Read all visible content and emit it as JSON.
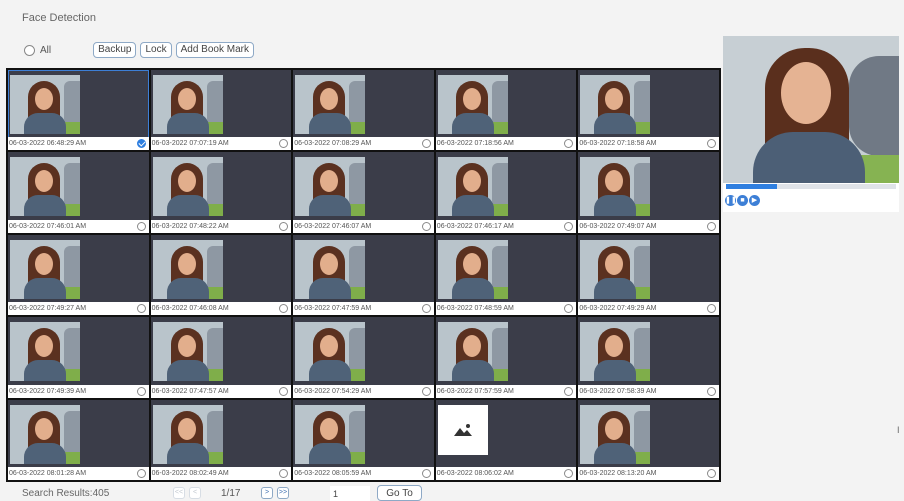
{
  "title": "Face Detection",
  "toolbar": {
    "all_label": "All",
    "backup_label": "Backup",
    "lock_label": "Lock",
    "bookmark_label": "Add Book Mark"
  },
  "grid": {
    "items": [
      {
        "timestamp": "06-03-2022 06:48:29 AM",
        "checked": true
      },
      {
        "timestamp": "06-03-2022 07:07:19 AM",
        "checked": false
      },
      {
        "timestamp": "06-03-2022 07:08:29 AM",
        "checked": false
      },
      {
        "timestamp": "06-03-2022 07:18:56 AM",
        "checked": false
      },
      {
        "timestamp": "06-03-2022 07:18:58 AM",
        "checked": false
      },
      {
        "timestamp": "06-03-2022 07:46:01 AM",
        "checked": false
      },
      {
        "timestamp": "06-03-2022 07:48:22 AM",
        "checked": false
      },
      {
        "timestamp": "06-03-2022 07:46:07 AM",
        "checked": false
      },
      {
        "timestamp": "06-03-2022 07:46:17 AM",
        "checked": false
      },
      {
        "timestamp": "06-03-2022 07:49:07 AM",
        "checked": false
      },
      {
        "timestamp": "06-03-2022 07:49:27 AM",
        "checked": false
      },
      {
        "timestamp": "06-03-2022 07:46:08 AM",
        "checked": false
      },
      {
        "timestamp": "06-03-2022 07:47:59 AM",
        "checked": false
      },
      {
        "timestamp": "06-03-2022 07:48:59 AM",
        "checked": false
      },
      {
        "timestamp": "06-03-2022 07:49:29 AM",
        "checked": false
      },
      {
        "timestamp": "06-03-2022 07:49:39 AM",
        "checked": false
      },
      {
        "timestamp": "06-03-2022 07:47:57 AM",
        "checked": false
      },
      {
        "timestamp": "06-03-2022 07:54:29 AM",
        "checked": false
      },
      {
        "timestamp": "06-03-2022 07:57:59 AM",
        "checked": false
      },
      {
        "timestamp": "06-03-2022 07:58:39 AM",
        "checked": false
      },
      {
        "timestamp": "06-03-2022 08:01:28 AM",
        "checked": false
      },
      {
        "timestamp": "06-03-2022 08:02:49 AM",
        "checked": false
      },
      {
        "timestamp": "06-03-2022 08:05:59 AM",
        "checked": false
      },
      {
        "timestamp": "06-03-2022 08:06:02 AM",
        "checked": false,
        "placeholder": true
      },
      {
        "timestamp": "06-03-2022 08:13:20 AM",
        "checked": false
      }
    ]
  },
  "preview": {
    "progress": 0.3,
    "controls": [
      "pause-icon",
      "stop-icon",
      "forward-icon"
    ],
    "accent": "#2f7fe0"
  },
  "footer": {
    "results": "Search Results:405",
    "first": "<<",
    "prev": "<",
    "page": "1/17",
    "next": ">",
    "last": ">>",
    "page_input": "1",
    "goto_label": "Go To"
  }
}
